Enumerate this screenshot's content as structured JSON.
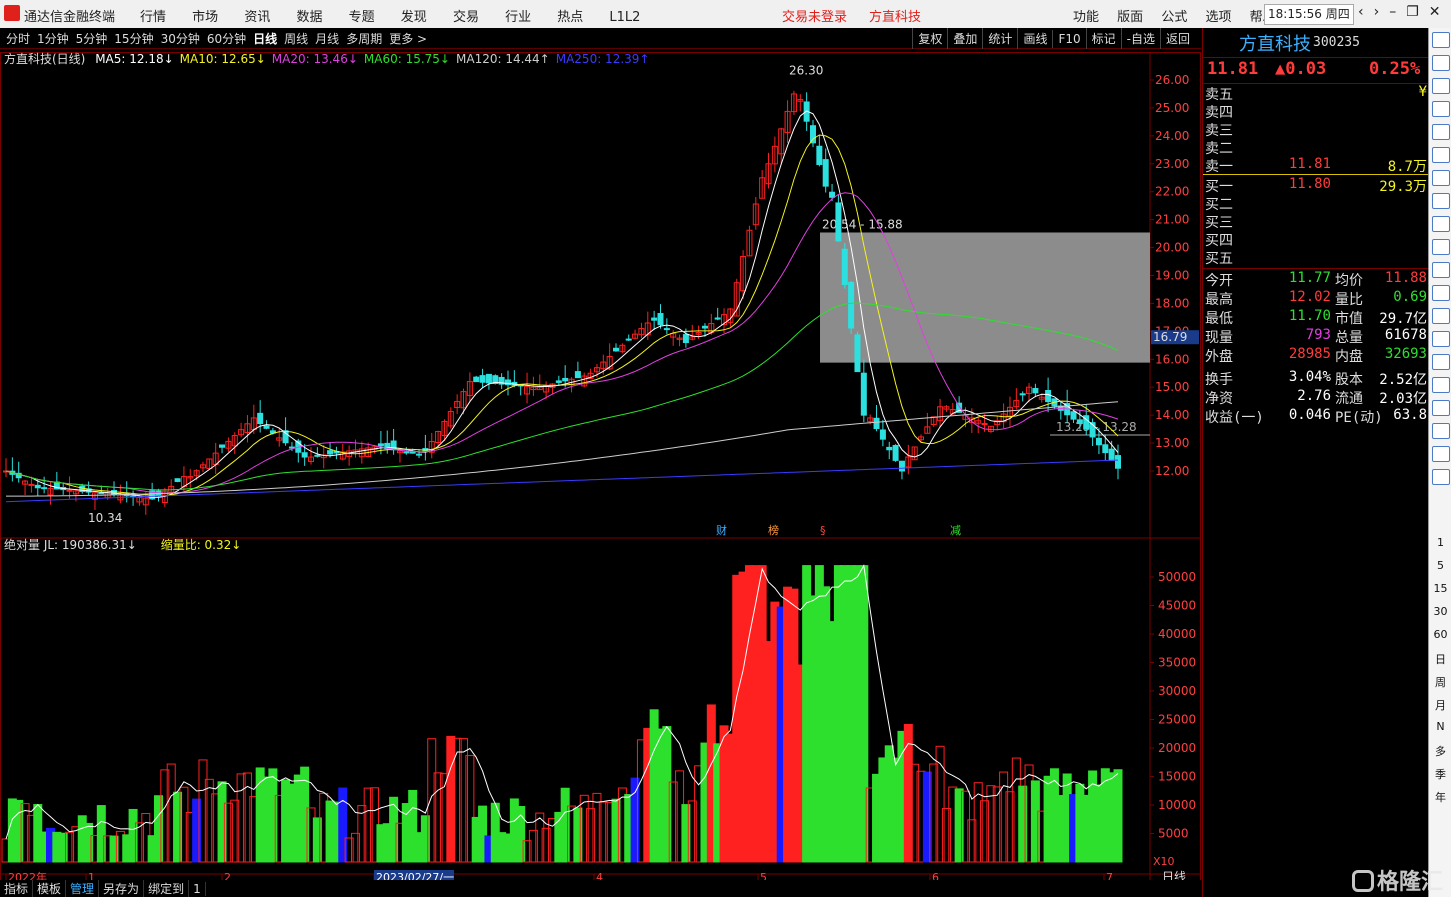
{
  "app": {
    "title": "通达信金融终端",
    "menu": [
      "行情",
      "市场",
      "资讯",
      "数据",
      "专题",
      "发现",
      "交易",
      "行业",
      "热点",
      "L1L2"
    ],
    "login_status": "交易未登录",
    "stock_name_title": "方直科技",
    "right_menu": [
      "功能",
      "版面",
      "公式",
      "选项",
      "帮助"
    ],
    "time": "18:15:56",
    "weekday": "周四"
  },
  "toolbar": {
    "periods": [
      "分时",
      "1分钟",
      "5分钟",
      "15分钟",
      "30分钟",
      "60分钟",
      "日线",
      "周线",
      "月线",
      "多周期",
      "更多 >"
    ],
    "active_period": "日线",
    "tools": [
      "复权",
      "叠加",
      "统计",
      "画线",
      "F10",
      "标记",
      "-自选",
      "返回"
    ]
  },
  "chart": {
    "header": "方直科技(日线)",
    "ma": [
      {
        "label": "MA5: 12.18↓",
        "color": "#ffffff"
      },
      {
        "label": "MA10: 12.65↓",
        "color": "#f3f31f"
      },
      {
        "label": "MA20: 13.46↓",
        "color": "#e040e0"
      },
      {
        "label": "MA60: 15.75↓",
        "color": "#2de02d"
      },
      {
        "label": "MA120: 14.44↑",
        "color": "#cccccc"
      },
      {
        "label": "MA250: 12.39↑",
        "color": "#3b3bff"
      }
    ],
    "price_axis": [
      "26.00",
      "25.00",
      "24.00",
      "23.00",
      "22.00",
      "21.00",
      "20.00",
      "19.00",
      "18.00",
      "17.00",
      "16.00",
      "15.00",
      "14.00",
      "13.00",
      "12.00"
    ],
    "axis_highlight": "16.79",
    "annotations": {
      "high": "26.30",
      "low": "10.34",
      "box_range": "20.54 - 15.88",
      "box_range2": "13.29 - 13.28"
    },
    "event_markers": [
      "财",
      "榜",
      "§",
      "减"
    ],
    "volume_header": "绝对量  JL: 190386.31↓",
    "volume_ratio": "缩量比: 0.32↓",
    "volume_axis": [
      "50000",
      "45000",
      "40000",
      "35000",
      "30000",
      "25000",
      "20000",
      "15000",
      "10000",
      "5000"
    ],
    "volume_unit": "X10",
    "date_axis": [
      "2022年",
      "1",
      "2",
      "2023/02/27/一",
      "4",
      "5",
      "6",
      "7"
    ],
    "bottom_period": "日线"
  },
  "bottom_tabs": [
    "指标",
    "模板",
    "管理",
    "另存为",
    "绑定到",
    "1"
  ],
  "quote": {
    "name": "方直科技",
    "code": "300235",
    "price": "11.81",
    "change": "▲0.03",
    "pct": "0.25%",
    "asks": [
      {
        "label": "卖五",
        "price": "",
        "vol": "¥"
      },
      {
        "label": "卖四",
        "price": "",
        "vol": ""
      },
      {
        "label": "卖三",
        "price": "",
        "vol": ""
      },
      {
        "label": "卖二",
        "price": "",
        "vol": ""
      },
      {
        "label": "卖一",
        "price": "11.81",
        "vol": "8.7万"
      }
    ],
    "bids": [
      {
        "label": "买一",
        "price": "11.80",
        "vol": "29.3万"
      },
      {
        "label": "买二",
        "price": "",
        "vol": ""
      },
      {
        "label": "买三",
        "price": "",
        "vol": ""
      },
      {
        "label": "买四",
        "price": "",
        "vol": ""
      },
      {
        "label": "买五",
        "price": "",
        "vol": ""
      }
    ],
    "stats": [
      {
        "l": "今开",
        "v": "11.77",
        "c": "green",
        "l2": "均价",
        "v2": "11.88",
        "c2": "red"
      },
      {
        "l": "最高",
        "v": "12.02",
        "c": "red",
        "l2": "量比",
        "v2": "0.69",
        "c2": "green"
      },
      {
        "l": "最低",
        "v": "11.70",
        "c": "green",
        "l2": "市值",
        "v2": "29.7亿",
        "c2": "white"
      },
      {
        "l": "现量",
        "v": "793",
        "c": "magenta",
        "l2": "总量",
        "v2": "61678",
        "c2": "white"
      },
      {
        "l": "外盘",
        "v": "28985",
        "c": "red",
        "l2": "内盘",
        "v2": "32693",
        "c2": "green"
      },
      {
        "l": "换手",
        "v": "3.04%",
        "c": "white",
        "l2": "股本",
        "v2": "2.52亿",
        "c2": "white"
      },
      {
        "l": "净资",
        "v": "2.76",
        "c": "white",
        "l2": "流通",
        "v2": "2.03亿",
        "c2": "white"
      },
      {
        "l": "收益(一)",
        "v": "0.046",
        "c": "white",
        "l2": "PE(动)",
        "v2": "63.8",
        "c2": "white"
      }
    ]
  },
  "icon_strip": {
    "icons": [
      "arrow-left-icon",
      "arrow-up-icon",
      "arrow-up-outline-icon",
      "chart-icon",
      "grid-icon",
      "line-chart-icon",
      "candle-icon",
      "fin-icon",
      "info-icon",
      "doc-icon",
      "fiz-icon",
      "dollar-icon",
      "circle-icon",
      "wave-icon",
      "rsi-icon",
      "target-icon",
      "move-icon",
      "list-icon",
      "f5-icon",
      "refresh-icon"
    ],
    "periods": [
      "1",
      "5",
      "15",
      "30",
      "60",
      "日",
      "周",
      "月",
      "N",
      "多",
      "季",
      "年"
    ]
  },
  "watermark": "格隆汇",
  "colors": {
    "up": "#ff2020",
    "down": "#2de0e0",
    "vol_up": "#ff2020",
    "vol_down": "#2de02d",
    "vol_blue": "#1a1aff"
  }
}
